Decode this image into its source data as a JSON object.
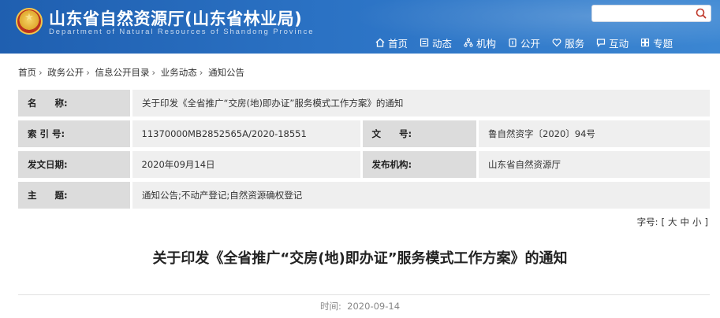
{
  "header": {
    "title": "山东省自然资源厅(山东省林业局)",
    "subtitle": "Department of Natural Resources of Shandong Province",
    "search_placeholder": "",
    "nav": [
      {
        "label": "首页",
        "icon": "home-icon"
      },
      {
        "label": "动态",
        "icon": "news-icon"
      },
      {
        "label": "机构",
        "icon": "org-icon"
      },
      {
        "label": "公开",
        "icon": "disclosure-icon"
      },
      {
        "label": "服务",
        "icon": "heart-icon"
      },
      {
        "label": "互动",
        "icon": "chat-icon"
      },
      {
        "label": "专题",
        "icon": "topic-icon"
      }
    ]
  },
  "breadcrumb": [
    "首页",
    "政务公开",
    "信息公开目录",
    "业务动态",
    "通知公告"
  ],
  "info": {
    "name_label": "名　　称:",
    "name_value": "关于印发《全省推广“交房(地)即办证”服务模式工作方案》的通知",
    "index_label": "索 引 号:",
    "index_value": "11370000MB2852565A/2020-18551",
    "doc_label": "文　　号:",
    "doc_value": "鲁自然资字〔2020〕94号",
    "date_label": "发文日期:",
    "date_value": "2020年09月14日",
    "org_label": "发布机构:",
    "org_value": "山东省自然资源厅",
    "topic_label": "主　　题:",
    "topic_value": "通知公告;不动产登记;自然资源确权登记"
  },
  "fontsize": {
    "label": "字号:",
    "open": "[",
    "large": "大",
    "medium": "中",
    "small": "小",
    "close": "]"
  },
  "article": {
    "title": "关于印发《全省推广“交房(地)即办证”服务模式工作方案》的通知",
    "time_label": "时间:",
    "time_value": "2020-09-14"
  },
  "colors": {
    "header_blue": "#2b72c4",
    "label_bg": "#dcdcdc",
    "value_bg": "#efefef"
  }
}
